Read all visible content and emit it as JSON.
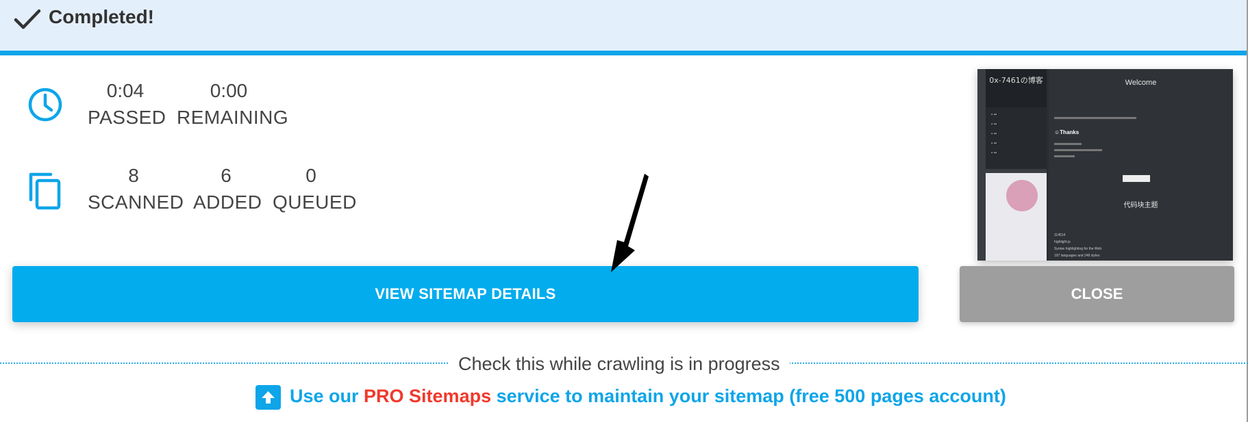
{
  "header": {
    "title": "Completed!"
  },
  "time": {
    "passed": {
      "value": "0:04",
      "label": "PASSED"
    },
    "remaining": {
      "value": "0:00",
      "label": "REMAINING"
    }
  },
  "pages": {
    "scanned": {
      "value": "8",
      "label": "SCANNED"
    },
    "added": {
      "value": "6",
      "label": "ADDED"
    },
    "queued": {
      "value": "0",
      "label": "QUEUED"
    }
  },
  "thumbnail": {
    "blog_title": "0x-7461の博客",
    "welcome": "Welcome",
    "thanks": "☺Thanks",
    "code_title": "代码块主题",
    "line1": "114514",
    "line2": "highlight.js",
    "line3": "Syntax highlighting for the Web",
    "line4": "197 languages and 248 styles"
  },
  "actions": {
    "view_label": "VIEW SITEMAP DETAILS",
    "close_label": "CLOSE"
  },
  "footer": {
    "divider_text": "Check this while crawling is in progress",
    "promo_before": "Use our ",
    "promo_pro": "PRO Sitemaps",
    "promo_after": " service to maintain your sitemap (free 500 pages account)"
  },
  "colors": {
    "accent": "#03aced",
    "header_bg": "#e3effb",
    "close_bg": "#9e9e9e",
    "pro_red": "#f0392b"
  }
}
